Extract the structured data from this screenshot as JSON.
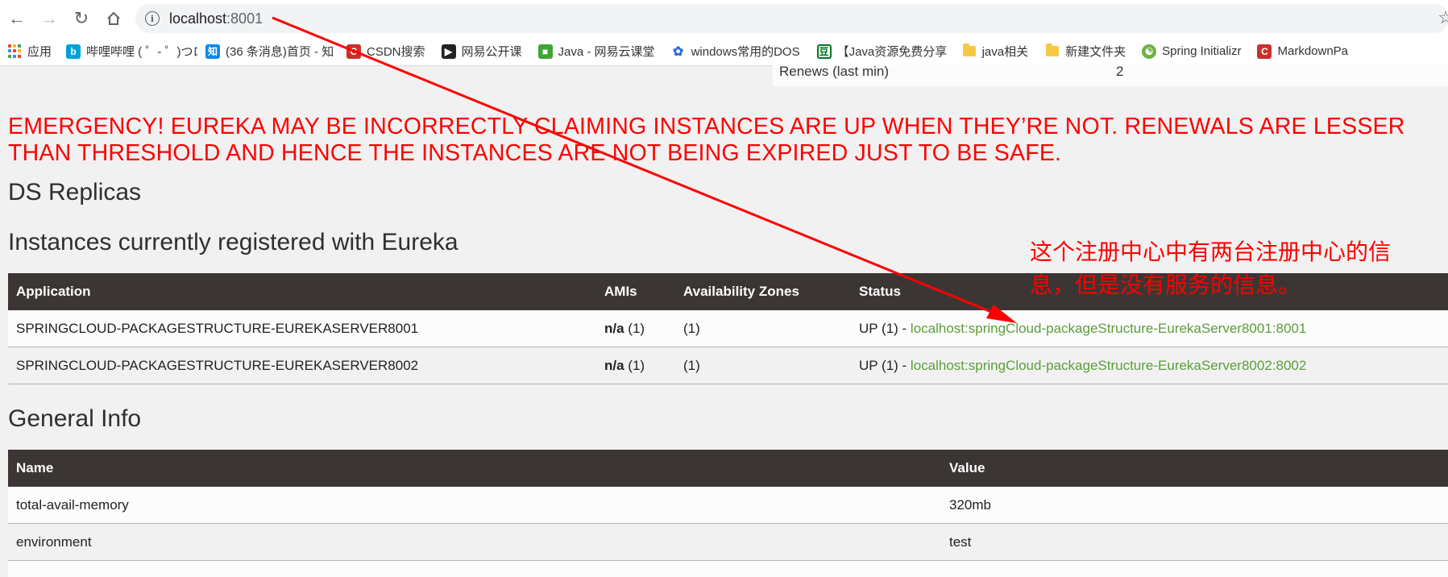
{
  "browser": {
    "url_host": "localhost",
    "url_port": ":8001",
    "back_icon": "back-arrow-icon",
    "forward_icon": "forward-arrow-icon",
    "reload_icon": "reload-icon",
    "home_icon": "home-icon"
  },
  "bookmarks": [
    {
      "label": "应用"
    },
    {
      "label": "哔哩哔哩 ( ゜- ゜)つロ"
    },
    {
      "label": "(36 条消息)首页 - 知"
    },
    {
      "label": "CSDN搜索"
    },
    {
      "label": "网易公开课"
    },
    {
      "label": "Java - 网易云课堂"
    },
    {
      "label": "windows常用的DOS"
    },
    {
      "label": "【Java资源免费分享"
    },
    {
      "label": "java相关"
    },
    {
      "label": "新建文件夹"
    },
    {
      "label": "Spring Initializr"
    },
    {
      "label": "MarkdownPa"
    }
  ],
  "stats_strip": {
    "name": "Renews (last min)",
    "value": "2"
  },
  "emergency_line1": "EMERGENCY! EUREKA MAY BE INCORRECTLY CLAIMING INSTANCES ARE UP WHEN THEY’RE NOT. RENEWALS ARE LESSER",
  "emergency_line2": "THAN THRESHOLD AND HENCE THE INSTANCES ARE NOT BEING EXPIRED JUST TO BE SAFE.",
  "ds_replicas_title": "DS Replicas",
  "instances_title": "Instances currently registered with Eureka",
  "instances_table": {
    "headers": [
      "Application",
      "AMIs",
      "Availability Zones",
      "Status"
    ],
    "rows": [
      {
        "app": "SPRINGCLOUD-PACKAGESTRUCTURE-EUREKASERVER8001",
        "amis_bold": "n/a",
        "amis_count": " (1)",
        "zones": "(1)",
        "status_prefix": "UP (1) - ",
        "status_link": "localhost:springCloud-packageStructure-EurekaServer8001:8001"
      },
      {
        "app": "SPRINGCLOUD-PACKAGESTRUCTURE-EUREKASERVER8002",
        "amis_bold": "n/a",
        "amis_count": " (1)",
        "zones": "(1)",
        "status_prefix": "UP (1) - ",
        "status_link": "localhost:springCloud-packageStructure-EurekaServer8002:8002"
      }
    ]
  },
  "annotation_line1": "这个注册中心中有两台注册中心的信",
  "annotation_line2": "息，但是没有服务的信息。",
  "general_info_title": "General Info",
  "general_table": {
    "headers": [
      "Name",
      "Value"
    ],
    "rows": [
      {
        "name": "total-avail-memory",
        "value": "320mb"
      },
      {
        "name": "environment",
        "value": "test"
      }
    ]
  },
  "colors": {
    "emergency": "#ff0000",
    "table_header": "#3b3634",
    "link": "#5b9e3a",
    "annotation_arrow": "#ff0000"
  }
}
